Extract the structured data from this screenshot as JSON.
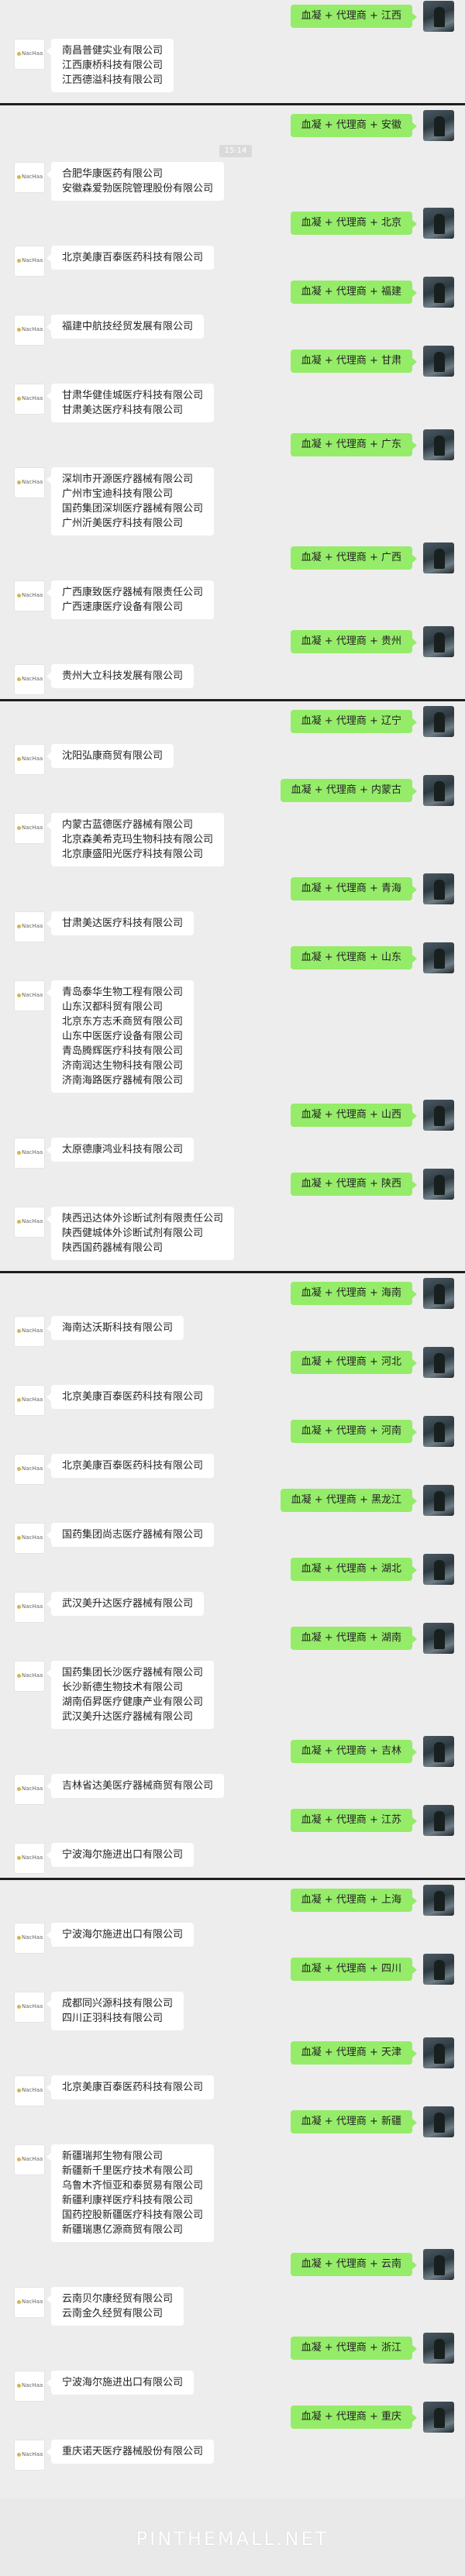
{
  "avatar_label": "NacHaa",
  "timestamp": "15:14",
  "messages": [
    {
      "type": "out",
      "text": "血凝 + 代理商 + 江西"
    },
    {
      "type": "in",
      "lines": [
        "南昌普健实业有限公司",
        "江西康桥科技有限公司",
        "江西德溢科技有限公司"
      ]
    },
    {
      "type": "sep"
    },
    {
      "type": "out",
      "text": "血凝 + 代理商 + 安徽"
    },
    {
      "type": "time"
    },
    {
      "type": "in",
      "lines": [
        "合肥华康医药有限公司",
        "安徽森爱勃医院管理股份有限公司"
      ]
    },
    {
      "type": "out",
      "text": "血凝 + 代理商 + 北京"
    },
    {
      "type": "in",
      "lines": [
        "北京美康百泰医药科技有限公司"
      ]
    },
    {
      "type": "out",
      "text": "血凝 + 代理商 + 福建"
    },
    {
      "type": "in",
      "lines": [
        "福建中航技经贸发展有限公司"
      ]
    },
    {
      "type": "out",
      "text": "血凝 + 代理商 + 甘肃"
    },
    {
      "type": "in",
      "lines": [
        "甘肃华健佳城医疗科技有限公司",
        "甘肃美达医疗科技有限公司"
      ]
    },
    {
      "type": "out",
      "text": "血凝 + 代理商 + 广东"
    },
    {
      "type": "in",
      "lines": [
        "深圳市开源医疗器械有限公司",
        "广州市宝迪科技有限公司",
        "国药集团深圳医疗器械有限公司",
        "广州沂美医疗科技有限公司"
      ]
    },
    {
      "type": "out",
      "text": "血凝 + 代理商 + 广西"
    },
    {
      "type": "in",
      "lines": [
        "广西康致医疗器械有限责任公司",
        "广西速康医疗设备有限公司"
      ]
    },
    {
      "type": "out",
      "text": "血凝 + 代理商 + 贵州"
    },
    {
      "type": "in",
      "lines": [
        "贵州大立科技发展有限公司"
      ]
    },
    {
      "type": "sep"
    },
    {
      "type": "out",
      "text": "血凝 + 代理商 + 辽宁"
    },
    {
      "type": "in",
      "lines": [
        "沈阳弘康商贸有限公司"
      ]
    },
    {
      "type": "out",
      "text": "血凝 + 代理商 + 内蒙古"
    },
    {
      "type": "in",
      "lines": [
        "内蒙古蓝德医疗器械有限公司",
        "北京森美希克玛生物科技有限公司",
        "北京康盛阳光医疗科技有限公司"
      ]
    },
    {
      "type": "out",
      "text": "血凝 + 代理商 + 青海"
    },
    {
      "type": "in",
      "lines": [
        "甘肃美达医疗科技有限公司"
      ]
    },
    {
      "type": "out",
      "text": "血凝 + 代理商 + 山东"
    },
    {
      "type": "in",
      "lines": [
        "青岛泰华生物工程有限公司",
        "山东汉都科贸有限公司",
        "北京东方志禾商贸有限公司",
        "山东中医医疗设备有限公司",
        "青岛腾辉医疗科技有限公司",
        "济南润达生物科技有限公司",
        "济南海路医疗器械有限公司"
      ]
    },
    {
      "type": "out",
      "text": "血凝 + 代理商 + 山西"
    },
    {
      "type": "in",
      "lines": [
        "太原德康鸿业科技有限公司"
      ]
    },
    {
      "type": "out",
      "text": "血凝 + 代理商 + 陕西"
    },
    {
      "type": "in",
      "lines": [
        "陕西迅达体外诊断试剂有限责任公司",
        "陕西健城体外诊断试剂有限公司",
        "陕西国药器械有限公司"
      ]
    },
    {
      "type": "sep"
    },
    {
      "type": "out",
      "text": "血凝 + 代理商 + 海南"
    },
    {
      "type": "in",
      "lines": [
        "海南达沃斯科技有限公司"
      ]
    },
    {
      "type": "out",
      "text": "血凝 + 代理商 + 河北"
    },
    {
      "type": "in",
      "lines": [
        "北京美康百泰医药科技有限公司"
      ]
    },
    {
      "type": "out",
      "text": "血凝 + 代理商 + 河南"
    },
    {
      "type": "in",
      "lines": [
        "北京美康百泰医药科技有限公司"
      ]
    },
    {
      "type": "out",
      "text": "血凝 + 代理商 + 黑龙江"
    },
    {
      "type": "in",
      "lines": [
        "国药集团尚志医疗器械有限公司"
      ]
    },
    {
      "type": "out",
      "text": "血凝 + 代理商 + 湖北"
    },
    {
      "type": "in",
      "lines": [
        "武汉美升达医疗器械有限公司"
      ]
    },
    {
      "type": "out",
      "text": "血凝 + 代理商 + 湖南"
    },
    {
      "type": "in",
      "lines": [
        "国药集团长沙医疗器械有限公司",
        "长沙新德生物技术有限公司",
        "湖南佰昇医疗健康产业有限公司",
        "武汉美升达医疗器械有限公司"
      ]
    },
    {
      "type": "out",
      "text": "血凝 + 代理商 + 吉林"
    },
    {
      "type": "in",
      "lines": [
        "吉林省达美医疗器械商贸有限公司"
      ]
    },
    {
      "type": "out",
      "text": "血凝 + 代理商 + 江苏"
    },
    {
      "type": "in",
      "lines": [
        "宁波海尔施进出口有限公司"
      ]
    },
    {
      "type": "sep"
    },
    {
      "type": "out",
      "text": "血凝 + 代理商 + 上海"
    },
    {
      "type": "in",
      "lines": [
        "宁波海尔施进出口有限公司"
      ]
    },
    {
      "type": "out",
      "text": "血凝 + 代理商 + 四川"
    },
    {
      "type": "in",
      "lines": [
        "成都同兴源科技有限公司",
        "四川正羽科技有限公司"
      ]
    },
    {
      "type": "out",
      "text": "血凝 + 代理商 + 天津"
    },
    {
      "type": "in",
      "lines": [
        "北京美康百泰医药科技有限公司"
      ]
    },
    {
      "type": "out",
      "text": "血凝 + 代理商 + 新疆"
    },
    {
      "type": "in",
      "lines": [
        "新疆瑞邦生物有限公司",
        "新疆新千里医疗技术有限公司",
        "乌鲁木齐恒亚和泰贸易有限公司",
        "新疆利康祥医疗科技有限公司",
        "国药控股新疆医疗科技有限公司",
        "新疆瑞惠亿源商贸有限公司"
      ]
    },
    {
      "type": "out",
      "text": "血凝 + 代理商 + 云南"
    },
    {
      "type": "in",
      "lines": [
        "云南贝尔康经贸有限公司",
        "云南金久经贸有限公司"
      ]
    },
    {
      "type": "out",
      "text": "血凝 + 代理商 + 浙江"
    },
    {
      "type": "in",
      "lines": [
        "宁波海尔施进出口有限公司"
      ]
    },
    {
      "type": "out",
      "text": "血凝 + 代理商 + 重庆"
    },
    {
      "type": "in",
      "lines": [
        "重庆诺天医疗器械股份有限公司"
      ]
    }
  ],
  "footer": {
    "brand": "PINTHEMALL.NET"
  }
}
